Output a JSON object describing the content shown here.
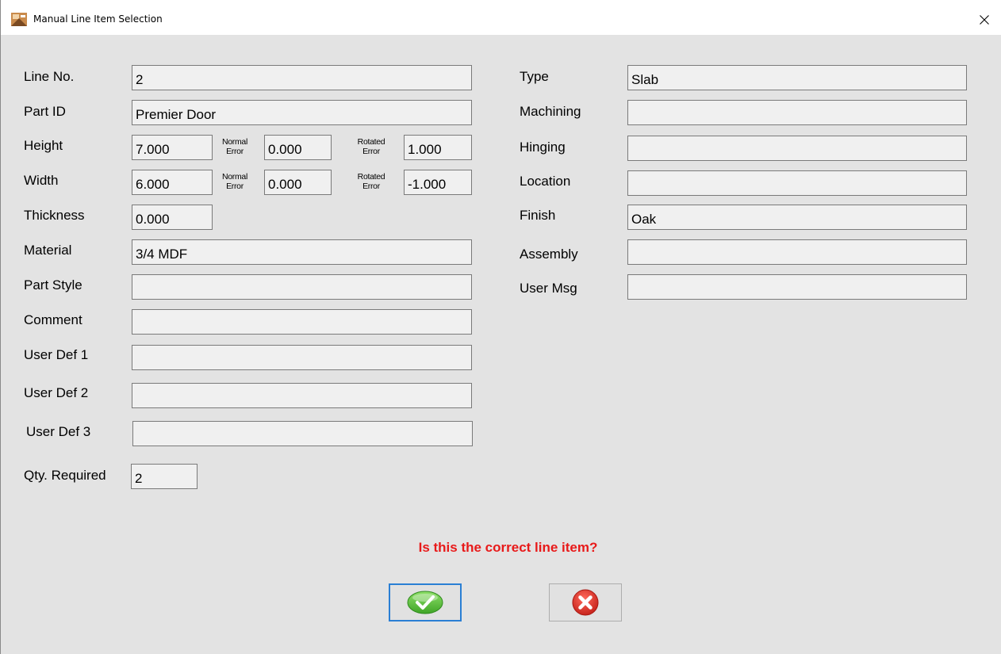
{
  "window": {
    "title": "Manual Line Item Selection"
  },
  "left_fields": {
    "line_no": {
      "label": "Line No.",
      "value": "2"
    },
    "part_id": {
      "label": "Part ID",
      "value": "Premier Door"
    },
    "height": {
      "label": "Height",
      "value": "7.000"
    },
    "width": {
      "label": "Width",
      "value": "6.000"
    },
    "thickness": {
      "label": "Thickness",
      "value": "0.000"
    },
    "material": {
      "label": "Material",
      "value": "3/4 MDF"
    },
    "part_style": {
      "label": "Part Style",
      "value": ""
    },
    "comment": {
      "label": "Comment",
      "value": ""
    },
    "user_def_1": {
      "label": "User Def 1",
      "value": ""
    },
    "user_def_2": {
      "label": "User Def 2",
      "value": ""
    },
    "user_def_3": {
      "label": "User Def 3",
      "value": ""
    },
    "qty_required": {
      "label": "Qty. Required",
      "value": "2"
    }
  },
  "errors": {
    "normal_label_1": "Normal",
    "normal_label_2": "Error",
    "rotated_label_1": "Rotated",
    "rotated_label_2": "Error",
    "height_normal": "0.000",
    "height_rotated": "1.000",
    "width_normal": "0.000",
    "width_rotated": "-1.000"
  },
  "right_fields": {
    "type": {
      "label": "Type",
      "value": "Slab"
    },
    "machining": {
      "label": "Machining",
      "value": ""
    },
    "hinging": {
      "label": "Hinging",
      "value": ""
    },
    "location": {
      "label": "Location",
      "value": ""
    },
    "finish": {
      "label": "Finish",
      "value": "Oak"
    },
    "assembly": {
      "label": "Assembly",
      "value": ""
    },
    "user_msg": {
      "label": "User Msg",
      "value": ""
    }
  },
  "prompt": {
    "question": "Is this the correct line item?"
  },
  "colors": {
    "question": "#e81a1a",
    "ok_button_border": "#2a7fd4",
    "ok_icon": "#4cb82e",
    "cancel_icon": "#e0332c"
  },
  "icons": {
    "app": "app-icon",
    "close": "close-icon",
    "ok": "checkmark-icon",
    "cancel": "x-cancel-icon"
  }
}
